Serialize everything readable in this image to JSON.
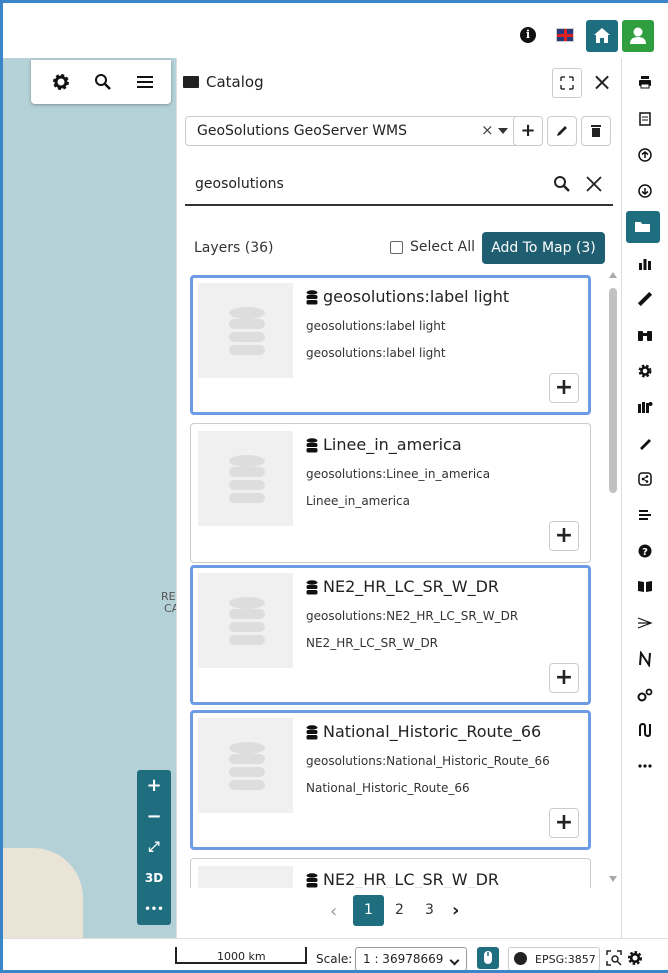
{
  "topbar": {
    "info_icon": "info-icon",
    "language_icon": "flag-uk-icon",
    "home_icon": "home-icon",
    "user_icon": "user-icon"
  },
  "colors": {
    "accent": "#1f6e80",
    "user": "#2e9e3e",
    "selected_border": "#6d9be6",
    "checkbox": "#1a73e8",
    "frame": "#3a86c8"
  },
  "map": {
    "toolbar_icons": [
      "gear-icon",
      "search-icon",
      "menu-icon"
    ],
    "labels": [
      "RE",
      "CA"
    ],
    "zoom": {
      "in": "+",
      "out": "−",
      "fullscreen": "⤢",
      "three_d": "3D",
      "more": "•••"
    }
  },
  "catalog": {
    "title": "Catalog",
    "service": "GeoSolutions GeoServer WMS",
    "clear": "×",
    "search_value": "geosolutions",
    "layers_label": "Layers (36)",
    "select_all": "Select All",
    "add_to_map": "Add To Map (3)",
    "items": [
      {
        "title": "geosolutions:label light",
        "name": "geosolutions:label light",
        "description": "geosolutions:label light",
        "checked": true
      },
      {
        "title": "Linee_in_america",
        "name": "geosolutions:Linee_in_america",
        "description": "Linee_in_america",
        "checked": false
      },
      {
        "title": "NE2_HR_LC_SR_W_DR",
        "name": "geosolutions:NE2_HR_LC_SR_W_DR",
        "description": "NE2_HR_LC_SR_W_DR",
        "checked": true
      },
      {
        "title": "National_Historic_Route_66",
        "name": "geosolutions:National_Historic_Route_66",
        "description": "National_Historic_Route_66",
        "checked": true
      },
      {
        "title": "NE2_HR_LC_SR_W_DR",
        "name": "",
        "description": "",
        "checked": false
      }
    ],
    "pagination": {
      "prev": "‹",
      "pages": [
        "1",
        "2",
        "3"
      ],
      "current": "1",
      "next": "›"
    }
  },
  "sidebar": {
    "items": [
      "print-icon",
      "document-icon",
      "upload-icon",
      "download-icon",
      "catalog-folder-icon",
      "chart-icon",
      "measure-icon",
      "binoculars-icon",
      "settings-icon",
      "map-templates-icon",
      "annotation-icon",
      "share-icon",
      "details-icon",
      "help-icon",
      "tutorial-book-icon",
      "street-view-icon",
      "north-arrow-icon",
      "geoprocessing-icon",
      "route-icon",
      "more-icon"
    ],
    "active": "catalog-folder-icon"
  },
  "footer": {
    "scalebar_label": "1000 km",
    "scale_label": "Scale:",
    "scale_value": "1 : 36978669",
    "crs": "EPSG:3857"
  }
}
